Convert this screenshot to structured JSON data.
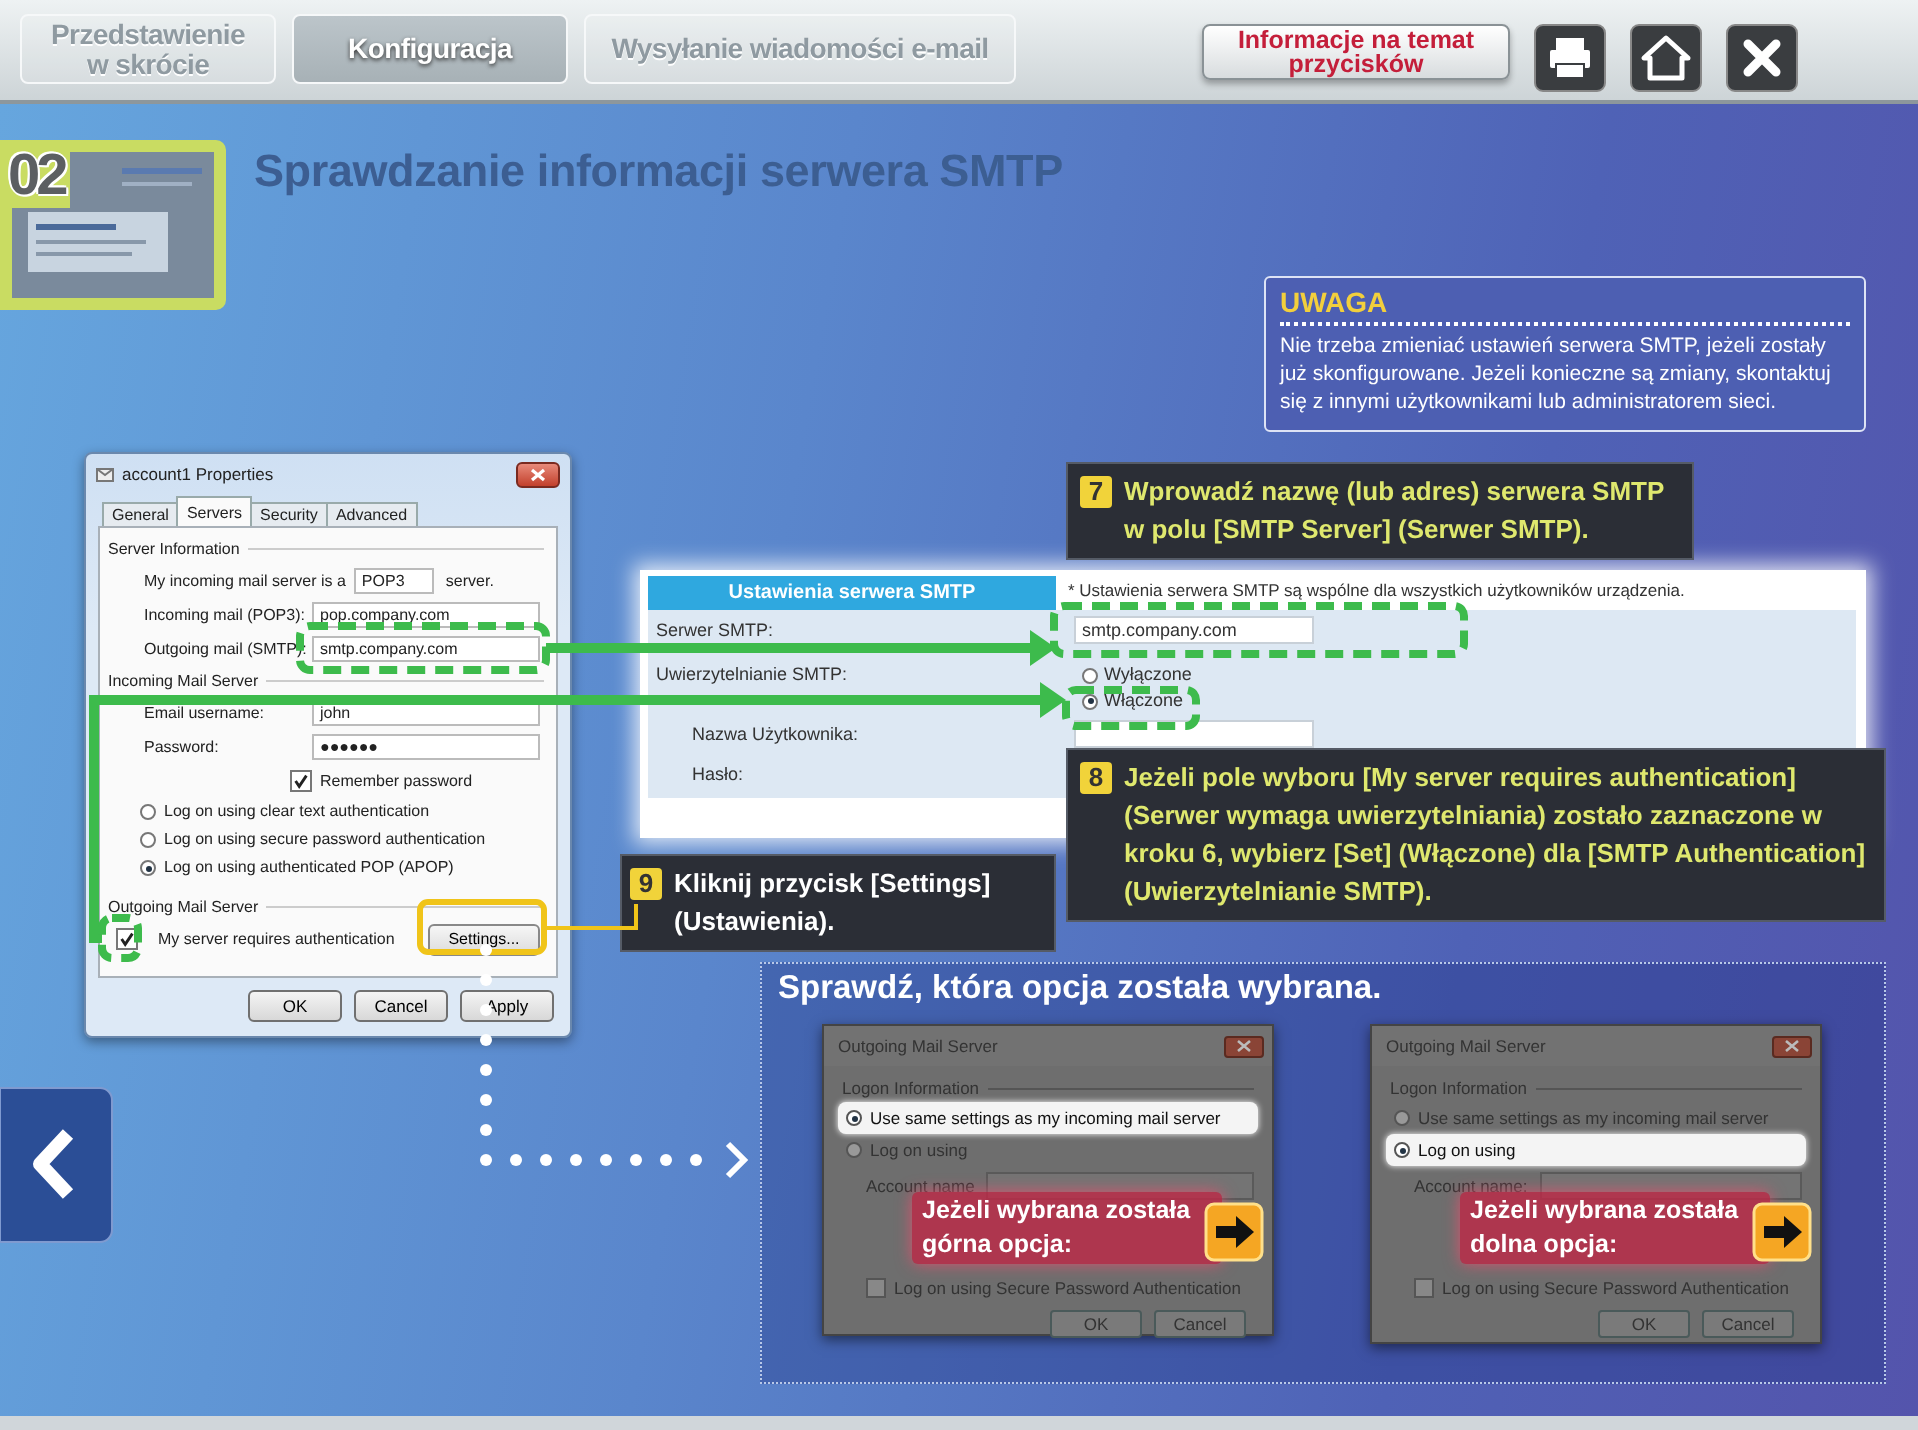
{
  "nav": {
    "tabs": [
      {
        "label": "Przedstawienie w skrócie",
        "selected": false
      },
      {
        "label": "Konfiguracja",
        "selected": true
      },
      {
        "label": "Wysyłanie wiadomości e-mail",
        "selected": false
      }
    ],
    "info_button": "Informacje na temat przycisków"
  },
  "step": {
    "number": "02",
    "title": "Sprawdzanie informacji serwera SMTP"
  },
  "note": {
    "title": "UWAGA",
    "text": "Nie trzeba zmieniać ustawień serwera SMTP, jeżeli zostały już skonfigurowane. Jeżeli konieczne są zmiany, skontaktuj się z innymi użytkownikami lub administratorem sieci."
  },
  "properties_dialog": {
    "title": "account1 Properties",
    "tabs": [
      {
        "label": "General",
        "selected": false
      },
      {
        "label": "Servers",
        "selected": true
      },
      {
        "label": "Security",
        "selected": false
      },
      {
        "label": "Advanced",
        "selected": false
      }
    ],
    "server_info": {
      "heading": "Server Information",
      "type_label": "My incoming mail server is a",
      "type_value": "POP3",
      "type_suffix": "server.",
      "fields": [
        {
          "label": "Incoming mail (POP3):",
          "value": "pop.company.com"
        },
        {
          "label": "Outgoing mail (SMTP):",
          "value": "smtp.company.com"
        }
      ]
    },
    "incoming": {
      "heading": "Incoming Mail Server",
      "fields": [
        {
          "label": "Email username:",
          "value": "john"
        },
        {
          "label": "Password:",
          "value": "●●●●●●"
        }
      ],
      "remember": {
        "label": "Remember password",
        "checked": true
      },
      "options": [
        {
          "label": "Log on using clear text authentication",
          "selected": false
        },
        {
          "label": "Log on using secure password authentication",
          "selected": false
        },
        {
          "label": "Log on using authenticated POP (APOP)",
          "selected": true
        }
      ]
    },
    "outgoing": {
      "heading": "Outgoing Mail Server",
      "auth": {
        "label": "My server requires authentication",
        "checked": true
      },
      "settings_button": "Settings..."
    },
    "buttons": [
      "OK",
      "Cancel",
      "Apply"
    ]
  },
  "callouts": [
    {
      "number": "7",
      "text": "Wprowadź nazwę (lub adres) serwera SMTP w polu [SMTP Server] (Serwer SMTP)."
    },
    {
      "number": "8",
      "text": "Jeżeli pole wyboru [My server requires authentication] (Serwer wymaga uwierzytelniania) zostało zaznaczone w kroku 6, wybierz [Set] (Włączone) dla [SMTP Authentication] (Uwierzytelnianie SMTP)."
    },
    {
      "number": "9",
      "text": "Kliknij przycisk [Settings] (Ustawienia)."
    }
  ],
  "smtp_form": {
    "header": "Ustawienia serwera SMTP",
    "note": "* Ustawienia serwera SMTP są wspólne dla wszystkich użytkowników urządzenia.",
    "server": {
      "label": "Serwer SMTP:",
      "value": "smtp.company.com"
    },
    "auth": {
      "label": "Uwierzytelnianie SMTP:",
      "options": [
        {
          "label": "Wyłączone",
          "selected": false
        },
        {
          "label": "Włączone",
          "selected": true
        }
      ]
    },
    "user_label": "Nazwa Użytkownika:",
    "password_label": "Hasło:"
  },
  "check_panel": {
    "title": "Sprawdź, która opcja została wybrana.",
    "dialogs": [
      {
        "title": "Outgoing Mail Server",
        "group": "Logon Information",
        "options": [
          {
            "label": "Use same settings as my incoming mail server",
            "selected": true
          },
          {
            "label": "Log on using",
            "selected": false
          }
        ],
        "account_label": "Account name",
        "spa": {
          "label": "Log on using Secure Password Authentication",
          "checked": false
        },
        "buttons": [
          "OK",
          "Cancel"
        ],
        "callout": "Jeżeli wybrana została górna opcja:"
      },
      {
        "title": "Outgoing Mail Server",
        "group": "Logon Information",
        "options": [
          {
            "label": "Use same settings as my incoming mail server",
            "selected": false
          },
          {
            "label": "Log on using",
            "selected": true
          }
        ],
        "account_label": "Account name:",
        "spa": {
          "label": "Log on using Secure Password Authentication",
          "checked": false
        },
        "buttons": [
          "OK",
          "Cancel"
        ],
        "callout": "Jeżeli wybrana została dolna opcja:"
      }
    ]
  }
}
